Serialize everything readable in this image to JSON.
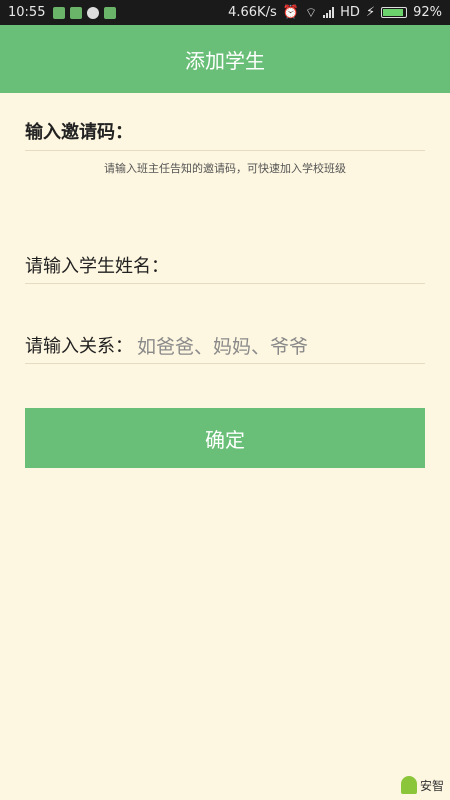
{
  "status_bar": {
    "time": "10:55",
    "speed": "4.66K/s",
    "network": "HD",
    "battery": "92%",
    "battery_level": 0.92
  },
  "app_bar": {
    "title": "添加学生"
  },
  "invite": {
    "label": "输入邀请码：",
    "hint": "请输入班主任告知的邀请码，可快速加入学校班级"
  },
  "student": {
    "label": "请输入学生姓名："
  },
  "relation": {
    "label": "请输入关系：",
    "placeholder": "如爸爸、妈妈、爷爷"
  },
  "confirm_button": {
    "label": "确定"
  },
  "watermark": {
    "text": "安智"
  }
}
